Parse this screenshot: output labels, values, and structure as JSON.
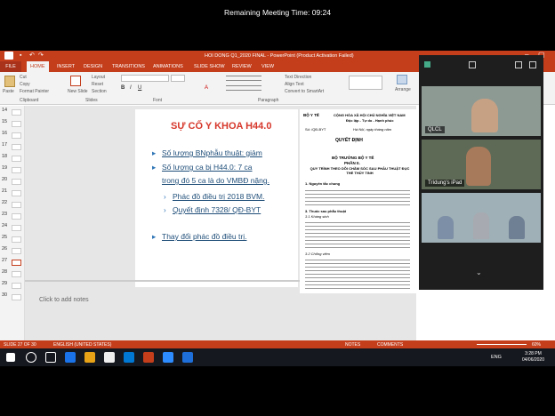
{
  "meeting": {
    "timer": "Remaining Meeting Time: 09:24"
  },
  "app": {
    "title": "HOI DONG Q1_2020 FINAL - PowerPoint (Product Activation Failed)"
  },
  "ribbon": {
    "tabs": [
      "FILE",
      "HOME",
      "INSERT",
      "DESIGN",
      "TRANSITIONS",
      "ANIMATIONS",
      "SLIDE SHOW",
      "REVIEW",
      "VIEW"
    ],
    "active_tab": "HOME",
    "clipboard": {
      "paste": "Paste",
      "cut": "Cut",
      "copy": "Copy",
      "format_painter": "Format Painter",
      "group": "Clipboard"
    },
    "slides": {
      "new_slide": "New Slide",
      "layout": "Layout",
      "reset": "Reset",
      "section": "Section",
      "group": "Slides"
    },
    "font_group": "Font",
    "paragraph": {
      "text_direction": "Text Direction",
      "align_text": "Align Text",
      "smartart": "Convert to SmartArt",
      "group": "Paragraph"
    },
    "drawing": {
      "arrange": "Arrange"
    }
  },
  "thumbnails": [
    "14",
    "15",
    "16",
    "17",
    "18",
    "19",
    "20",
    "21",
    "22",
    "23",
    "24",
    "25",
    "26",
    "27",
    "28",
    "29",
    "30"
  ],
  "slide": {
    "title": "SỰ CỐ Y KHOA H44.0",
    "bullet1": "Số lượng BNphẫu thuật: giảm",
    "bullet2a": "Số lượng ca bị H44.0: 7 ca",
    "bullet2b": "trong đó 5 ca là do VMBĐ nặng.",
    "sub1": "Phác đồ điều trị 2018 BVM.",
    "sub2": "Quyết định 7328/ QĐ-BYT",
    "bullet3": "Thay đổi phác đồ điều trị."
  },
  "notes_placeholder": "Click to add notes",
  "doc": {
    "org": "BỘ Y TẾ",
    "country": "CỘNG HÒA XÃ HỘI CHỦ NGHĨA VIỆT NAM",
    "motto": "Độc lập - Tự do - Hạnh phúc",
    "number": "Số: /QĐ-BYT",
    "date": "Hà Nội, ngày tháng năm",
    "heading": "QUYẾT ĐỊNH",
    "minister": "BỘ TRƯỞNG BỘ Y TẾ",
    "part": "PHẦN II.",
    "section": "QUY TRÌNH THEO DÕI CHĂM SÓC SAU PHẪU THUẬT ĐỤC THỂ THỦY TINH",
    "cause": "1. Nguyên tắc chung",
    "s3": "3. Thuốc sau phẫu thuật",
    "s31": "3.1 Kháng sinh",
    "s32": "3.2 Chống viêm"
  },
  "zoom": {
    "participant1": "QLCL",
    "participant2": "Trídung's iPad"
  },
  "status": {
    "slide": "SLIDE 27 OF 30",
    "lang": "ENGLISH (UNITED STATES)",
    "notes": "NOTES",
    "comments": "COMMENTS",
    "zoom": "60%"
  },
  "taskbar": {
    "lang": "ENG",
    "time": "3:28 PM",
    "date": "04/06/2020"
  }
}
